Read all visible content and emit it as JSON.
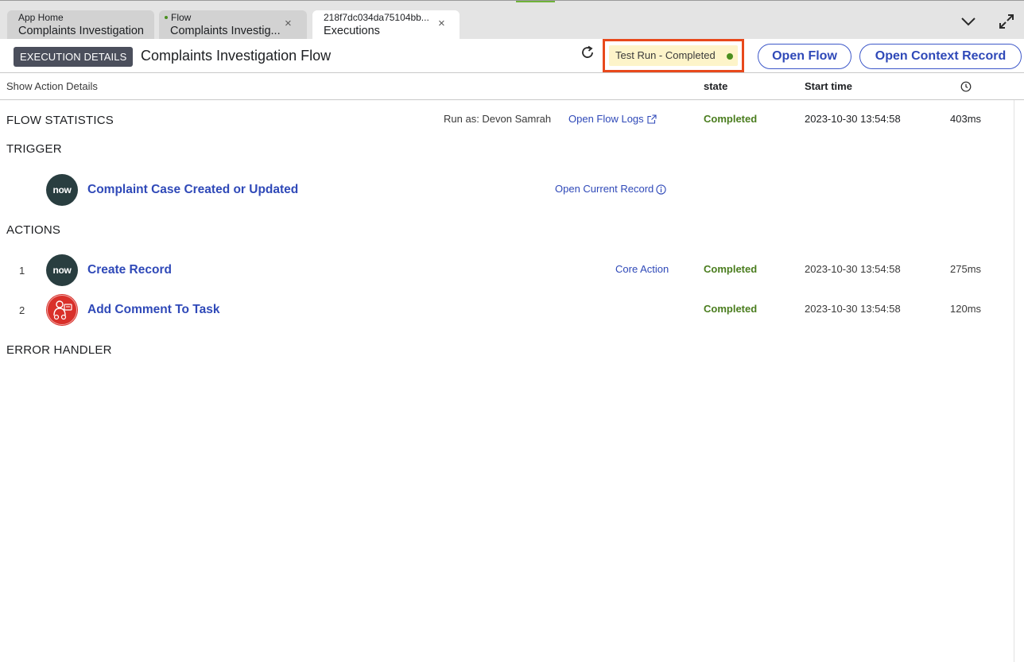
{
  "tabs": [
    {
      "subtitle": "App Home",
      "title": "Complaints Investigation"
    },
    {
      "subtitle": "Flow",
      "title": "Complaints Investig...",
      "close": "×"
    },
    {
      "subtitle": "218f7dc034da75104bb...",
      "title": "Executions",
      "close": "×"
    }
  ],
  "header": {
    "badge": "EXECUTION DETAILS",
    "title": "Complaints Investigation Flow",
    "status": "Test Run - Completed",
    "open_flow": "Open Flow",
    "open_context": "Open Context Record"
  },
  "columns": {
    "show_action_details": "Show Action Details",
    "state": "state",
    "start_time": "Start time"
  },
  "flow_stats": {
    "label": "FLOW STATISTICS",
    "run_as": "Run as: Devon Samrah",
    "open_logs": "Open Flow Logs",
    "state": "Completed",
    "time": "2023-10-30 13:54:58",
    "duration": "403ms"
  },
  "trigger": {
    "label": "TRIGGER",
    "icon_text": "now",
    "title": "Complaint Case Created or Updated",
    "open_record": "Open Current Record"
  },
  "actions": {
    "label": "ACTIONS",
    "items": [
      {
        "num": "1",
        "icon_text": "now",
        "title": "Create Record",
        "tag": "Core Action",
        "state": "Completed",
        "time": "2023-10-30 13:54:58",
        "duration": "275ms"
      },
      {
        "num": "2",
        "title": "Add Comment To Task",
        "tag": "",
        "state": "Completed",
        "time": "2023-10-30 13:54:58",
        "duration": "120ms"
      }
    ]
  },
  "error_handler": {
    "label": "ERROR HANDLER"
  },
  "colors": {
    "accent": "#2f49b8",
    "completed": "#4a7d1e",
    "highlight": "#e8491c",
    "status_bg": "#fdf4c9"
  }
}
